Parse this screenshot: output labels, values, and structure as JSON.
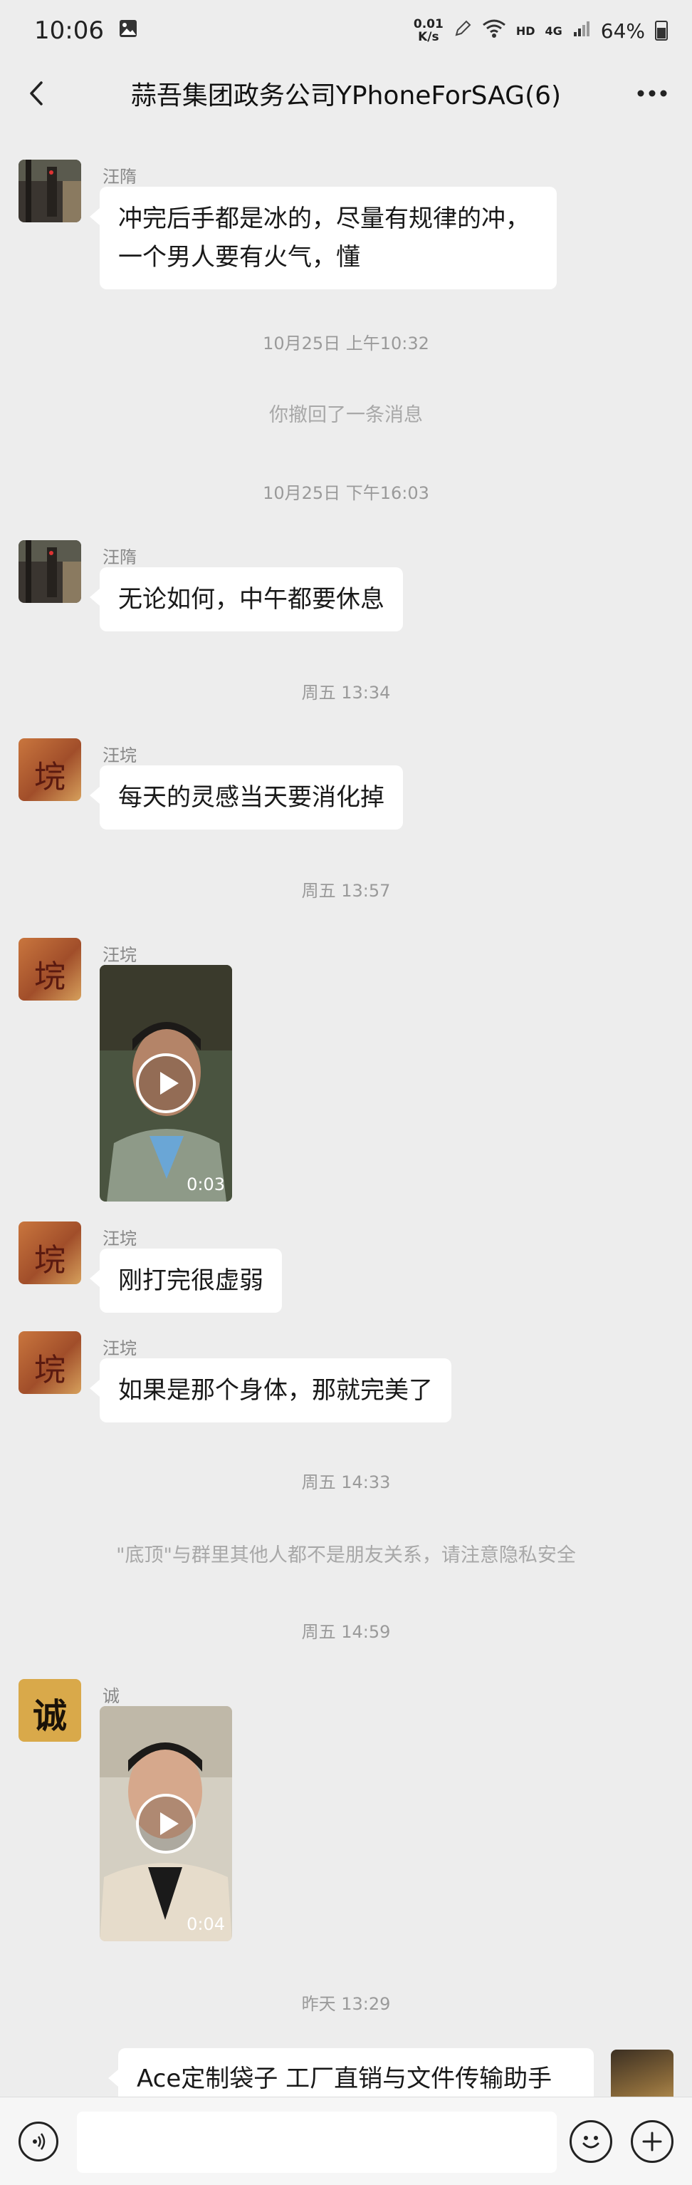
{
  "status": {
    "time": "10:06",
    "net_speed_value": "0.01",
    "net_speed_unit": "K/s",
    "hd": "HD",
    "network": "4G",
    "battery": "64%"
  },
  "header": {
    "title": "蒜吾集团政务公司YPhoneForSAG(6)"
  },
  "messages": {
    "m1": {
      "sender": "汪隋",
      "line1": "冲完后手都是冰的，尽量有规律的冲，",
      "line2": "一个男人要有火气，懂"
    },
    "t1": "10月25日 上午10:32",
    "sys1": "你撤回了一条消息",
    "t2": "10月25日 下午16:03",
    "m2": {
      "sender": "汪隋",
      "text": "无论如何，中午都要休息"
    },
    "t3": "周五 13:34",
    "m3": {
      "sender": "汪垸",
      "text": "每天的灵感当天要消化掉"
    },
    "t4": "周五 13:57",
    "m4": {
      "sender": "汪垸",
      "duration": "0:03"
    },
    "m5": {
      "sender": "汪垸",
      "text": "刚打完很虚弱"
    },
    "m6": {
      "sender": "汪垸",
      "text": "如果是那个身体，那就完美了"
    },
    "t5": "周五 14:33",
    "sys2": "\"底顶\"与群里其他人都不是朋友关系，请注意隐私安全",
    "t6": "周五 14:59",
    "m7": {
      "sender": "诚",
      "duration": "0:04"
    },
    "t7": "昨天 13:29",
    "m8": {
      "text": "Ace定制袋子  工厂直销与文件传输助手"
    }
  },
  "avatars": {
    "wang_gan_char": "垸",
    "cheng_char": "诚"
  }
}
